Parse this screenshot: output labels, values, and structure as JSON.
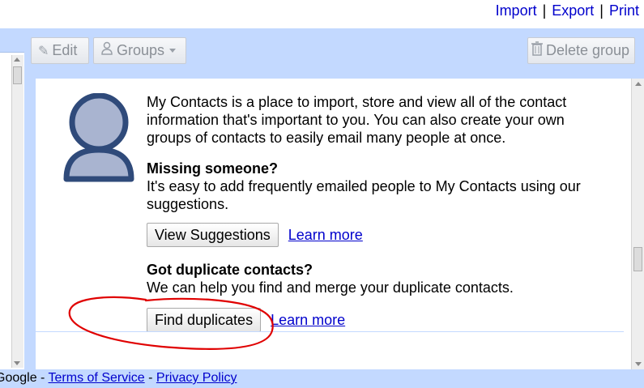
{
  "top_links": {
    "import": "Import",
    "export": "Export",
    "print": "Print",
    "separator": "|"
  },
  "toolbar": {
    "edit_label": "Edit",
    "groups_label": "Groups",
    "delete_group_label": "Delete group",
    "edit_icon": "pencil-icon",
    "groups_icon": "people-icon",
    "delete_icon": "trash-icon"
  },
  "main": {
    "intro": "My Contacts is a place to import, store and view all of the contact information that's important to you. You can also create your own groups of contacts to easily email many people at once.",
    "missing": {
      "heading": "Missing someone?",
      "text": "It's easy to add frequently emailed people to My Contacts using our suggestions.",
      "button_label": "View Suggestions",
      "link_label": "Learn more"
    },
    "duplicates": {
      "heading": "Got duplicate contacts?",
      "text": "We can help you find and merge your duplicate contacts.",
      "button_label": "Find duplicates",
      "link_label": "Learn more"
    }
  },
  "footer": {
    "brand": "Google",
    "separator": " - ",
    "terms": "Terms of Service",
    "privacy": "Privacy Policy"
  },
  "colors": {
    "panel_bg": "#c3d9ff",
    "link": "#0000cc",
    "avatar_fill": "#a9b4d0",
    "avatar_stroke": "#2f4a7a",
    "annotation": "#e00000"
  }
}
